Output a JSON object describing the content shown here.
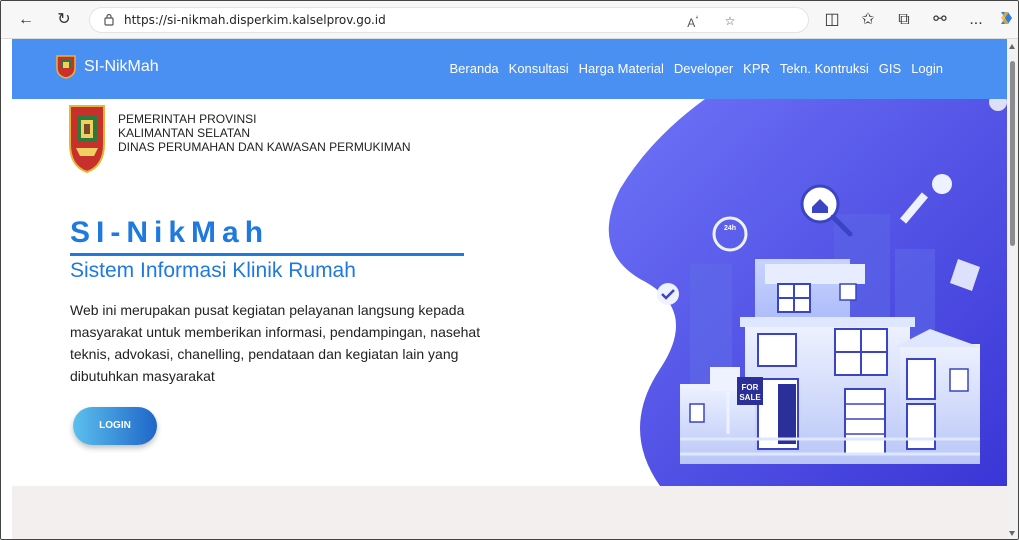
{
  "browser": {
    "url": "https://si-nikmah.disperkim.kalselprov.go.id",
    "more_label": "..."
  },
  "navbar": {
    "brand": "SI-NikMah",
    "links": [
      "Beranda",
      "Konsultasi",
      "Harga Material",
      "Developer",
      "KPR",
      "Tekn. Kontruksi",
      "GIS",
      "Login"
    ]
  },
  "hero": {
    "gov_lines": [
      "PEMERINTAH PROVINSI",
      "KALIMANTAN SELATAN",
      "DINAS PERUMAHAN DAN KAWASAN PERMUKIMAN"
    ],
    "title": "SI-NikMah",
    "subtitle": "Sistem Informasi Klinik Rumah",
    "description": "Web ini merupakan pusat kegiatan pelayanan langsung kepada masyarakat untuk memberikan informasi, pendampingan, nasehat teknis, advokasi, chanelling, pendataan dan kegiatan lain yang dibutuhkan masyarakat",
    "login_button": "LOGIN",
    "illustration": {
      "badge_24h": "24h",
      "sign_line1": "FOR",
      "sign_line2": "SALE"
    }
  },
  "colors": {
    "navbar": "#4a8ff2",
    "accent": "#1f7ae0",
    "blob": "#4b4ef0",
    "lower_section": "#f3efef"
  }
}
